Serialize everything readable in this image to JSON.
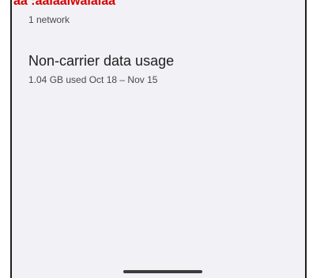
{
  "network_row": {
    "overlay_text": "aa :aalaalwalalaa",
    "count_text": "1 network"
  },
  "usage_row": {
    "title": "Non-carrier data usage",
    "summary": "1.04 GB used Oct 18 – Nov 15"
  }
}
